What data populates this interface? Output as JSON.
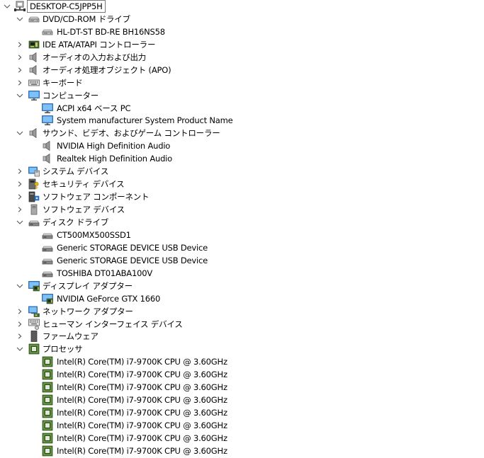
{
  "tree": {
    "rows": [
      {
        "label": "DESKTOP-C5JPP5H",
        "level": 0,
        "expand": "expanded",
        "icon": "computer-network-icon",
        "selected": true
      },
      {
        "label": "DVD/CD-ROM ドライブ",
        "level": 1,
        "expand": "expanded",
        "icon": "optical-drive-icon"
      },
      {
        "label": "HL-DT-ST BD-RE  BH16NS58",
        "level": 2,
        "expand": "none",
        "icon": "optical-drive-icon"
      },
      {
        "label": "IDE ATA/ATAPI コントローラー",
        "level": 1,
        "expand": "collapsed",
        "icon": "ide-controller-icon"
      },
      {
        "label": "オーディオの入力および出力",
        "level": 1,
        "expand": "collapsed",
        "icon": "speaker-icon"
      },
      {
        "label": "オーディオ処理オブジェクト (APO)",
        "level": 1,
        "expand": "collapsed",
        "icon": "speaker-icon"
      },
      {
        "label": "キーボード",
        "level": 1,
        "expand": "collapsed",
        "icon": "keyboard-icon"
      },
      {
        "label": "コンピューター",
        "level": 1,
        "expand": "expanded",
        "icon": "monitor-icon"
      },
      {
        "label": "ACPI x64 ベース PC",
        "level": 2,
        "expand": "none",
        "icon": "monitor-icon"
      },
      {
        "label": "System manufacturer System Product Name",
        "level": 2,
        "expand": "none",
        "icon": "monitor-icon"
      },
      {
        "label": "サウンド、ビデオ、およびゲーム コントローラー",
        "level": 1,
        "expand": "expanded",
        "icon": "speaker-icon"
      },
      {
        "label": "NVIDIA High Definition Audio",
        "level": 2,
        "expand": "none",
        "icon": "speaker-icon"
      },
      {
        "label": "Realtek High Definition Audio",
        "level": 2,
        "expand": "none",
        "icon": "speaker-icon"
      },
      {
        "label": "システム デバイス",
        "level": 1,
        "expand": "collapsed",
        "icon": "system-device-icon"
      },
      {
        "label": "セキュリティ デバイス",
        "level": 1,
        "expand": "collapsed",
        "icon": "security-key-icon"
      },
      {
        "label": "ソフトウェア コンポーネント",
        "level": 1,
        "expand": "collapsed",
        "icon": "software-component-icon"
      },
      {
        "label": "ソフトウェア デバイス",
        "level": 1,
        "expand": "collapsed",
        "icon": "software-device-icon"
      },
      {
        "label": "ディスク ドライブ",
        "level": 1,
        "expand": "expanded",
        "icon": "disk-drive-icon"
      },
      {
        "label": "CT500MX500SSD1",
        "level": 2,
        "expand": "none",
        "icon": "disk-drive-icon"
      },
      {
        "label": "Generic STORAGE DEVICE USB Device",
        "level": 2,
        "expand": "none",
        "icon": "disk-drive-icon"
      },
      {
        "label": "Generic STORAGE DEVICE USB Device",
        "level": 2,
        "expand": "none",
        "icon": "disk-drive-icon"
      },
      {
        "label": "TOSHIBA DT01ABA100V",
        "level": 2,
        "expand": "none",
        "icon": "disk-drive-icon"
      },
      {
        "label": "ディスプレイ アダプター",
        "level": 1,
        "expand": "expanded",
        "icon": "display-adapter-icon"
      },
      {
        "label": "NVIDIA GeForce GTX 1660",
        "level": 2,
        "expand": "none",
        "icon": "display-adapter-icon"
      },
      {
        "label": "ネットワーク アダプター",
        "level": 1,
        "expand": "collapsed",
        "icon": "network-adapter-icon"
      },
      {
        "label": "ヒューマン インターフェイス デバイス",
        "level": 1,
        "expand": "collapsed",
        "icon": "hid-icon"
      },
      {
        "label": "ファームウェア",
        "level": 1,
        "expand": "collapsed",
        "icon": "firmware-icon"
      },
      {
        "label": "プロセッサ",
        "level": 1,
        "expand": "expanded",
        "icon": "processor-icon"
      },
      {
        "label": "Intel(R) Core(TM) i7-9700K CPU @ 3.60GHz",
        "level": 2,
        "expand": "none",
        "icon": "processor-icon"
      },
      {
        "label": "Intel(R) Core(TM) i7-9700K CPU @ 3.60GHz",
        "level": 2,
        "expand": "none",
        "icon": "processor-icon"
      },
      {
        "label": "Intel(R) Core(TM) i7-9700K CPU @ 3.60GHz",
        "level": 2,
        "expand": "none",
        "icon": "processor-icon"
      },
      {
        "label": "Intel(R) Core(TM) i7-9700K CPU @ 3.60GHz",
        "level": 2,
        "expand": "none",
        "icon": "processor-icon"
      },
      {
        "label": "Intel(R) Core(TM) i7-9700K CPU @ 3.60GHz",
        "level": 2,
        "expand": "none",
        "icon": "processor-icon"
      },
      {
        "label": "Intel(R) Core(TM) i7-9700K CPU @ 3.60GHz",
        "level": 2,
        "expand": "none",
        "icon": "processor-icon"
      },
      {
        "label": "Intel(R) Core(TM) i7-9700K CPU @ 3.60GHz",
        "level": 2,
        "expand": "none",
        "icon": "processor-icon"
      },
      {
        "label": "Intel(R) Core(TM) i7-9700K CPU @ 3.60GHz",
        "level": 2,
        "expand": "none",
        "icon": "processor-icon"
      }
    ]
  },
  "colors": {
    "chevron": "#555555",
    "monitor": "#2b7bd1",
    "chip": "#4a7a2a"
  }
}
